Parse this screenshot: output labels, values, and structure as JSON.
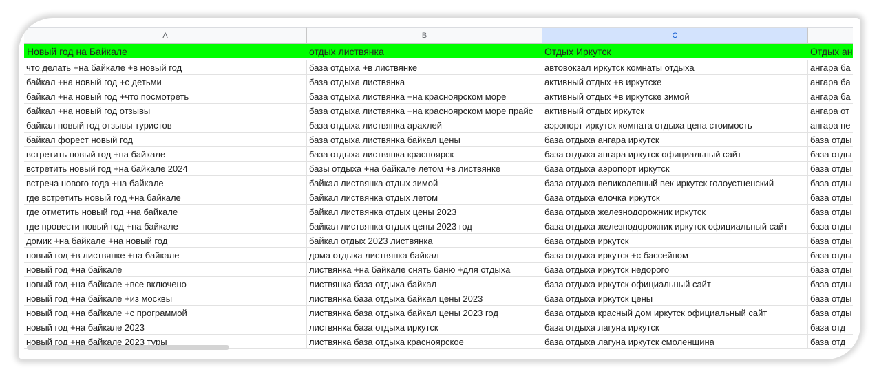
{
  "columns": [
    "A",
    "B",
    "C",
    ""
  ],
  "selected_column": "C",
  "header_row": [
    "Новый год на Байкале",
    "отдых листвянка",
    "Отдых Иркутск",
    "Отдых ан"
  ],
  "rows": [
    [
      "что делать +на байкале +в новый год",
      "база отдыха +в листвянке",
      "автовокзал иркутск комнаты отдыха",
      "ангара ба"
    ],
    [
      "байкал +на новый год +с детьми",
      "база отдыха листвянка",
      "активный отдых +в иркутске",
      "ангара ба"
    ],
    [
      "байкал +на новый год +что посмотреть",
      "база отдыха листвянка +на красноярском море",
      "активный отдых +в иркутске зимой",
      "ангара ба"
    ],
    [
      "байкал +на новый год отзывы",
      "база отдыха листвянка +на красноярском море прайс",
      "активный отдых иркутск",
      "ангара от"
    ],
    [
      "байкал новый год отзывы туристов",
      "база отдыха листвянка арахлей",
      "аэропорт иркутск комната отдыха цена стоимость",
      "ангара пе"
    ],
    [
      "байкал форест новый год",
      "база отдыха листвянка байкал цены",
      "база отдыха ангара иркутск",
      "база отды"
    ],
    [
      "встретить новый год +на байкале",
      "база отдыха листвянка красноярск",
      "база отдыха ангара иркутск официальный сайт",
      "база отды"
    ],
    [
      "встретить новый год +на байкале 2024",
      "базы отдыха +на байкале летом +в листвянке",
      "база отдыха аэропорт иркутск",
      "база отды"
    ],
    [
      "встреча нового года +на байкале",
      "байкал листвянка отдых зимой",
      "база отдыха великолепный век иркутск голоустненский",
      "база отды"
    ],
    [
      "где встретить новый год +на байкале",
      "байкал листвянка отдых летом",
      "база отдыха елочка иркутск",
      "база отды"
    ],
    [
      "где отметить новый год +на байкале",
      "байкал листвянка отдых цены 2023",
      "база отдыха железнодорожник иркутск",
      "база отды"
    ],
    [
      "где провести новый год +на байкале",
      "байкал листвянка отдых цены 2023 год",
      "база отдыха железнодорожник иркутск официальный сайт",
      "база отды"
    ],
    [
      "домик +на байкале +на новый год",
      "байкал отдых 2023 листвянка",
      "база отдыха иркутск",
      "база отды"
    ],
    [
      "новый год +в листвянке +на байкале",
      "дома отдыха листвянка байкал",
      "база отдыха иркутск +с бассейном",
      "база отды"
    ],
    [
      "новый год +на байкале",
      "листвянка +на байкале снять баню +для отдыха",
      "база отдыха иркутск недорого",
      "база отды"
    ],
    [
      "новый год +на байкале +все включено",
      "листвянка база отдыха байкал",
      "база отдыха иркутск официальный сайт",
      "база отды"
    ],
    [
      "новый год +на байкале +из москвы",
      "листвянка база отдыха байкал цены 2023",
      "база отдыха иркутск цены",
      "база отды"
    ],
    [
      "новый год +на байкале +с программой",
      "листвянка база отдыха байкал цены 2023 год",
      "база отдыха красный дом иркутск официальный сайт",
      "база отды"
    ],
    [
      "новый год +на байкале 2023",
      "листвянка база отдыха иркутск",
      "база отдыха лагуна иркутск",
      "база отд"
    ],
    [
      "новый год +на байкале 2023 туры",
      "листвянка база отдыха красноярское",
      "база отдыха лагуна иркутск смоленщина",
      "база отд"
    ]
  ]
}
